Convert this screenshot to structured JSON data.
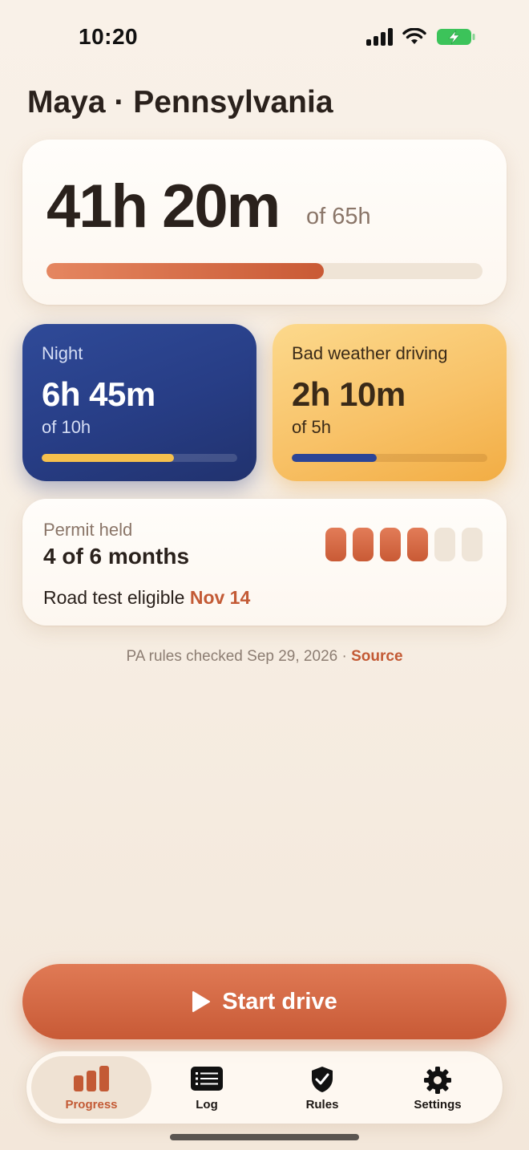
{
  "status_bar": {
    "time": "10:20",
    "icons": [
      "cellular-signal-icon",
      "wifi-icon",
      "battery-charging-icon"
    ],
    "battery_color": "#3cc35a"
  },
  "header": {
    "title": "Maya · Pennsylvania"
  },
  "total": {
    "value": "41h 20m",
    "of_label": "of 65h",
    "progress": 0.636,
    "fill_color": "#d46a45"
  },
  "night": {
    "label": "Night",
    "value": "6h 45m",
    "of_label": "of 10h",
    "progress": 0.675,
    "fill_color": "#f6c04d"
  },
  "weather": {
    "label": "Bad weather driving",
    "value": "2h 10m",
    "of_label": "of 5h",
    "progress": 0.433,
    "fill_color": "#2c4596"
  },
  "permit": {
    "label": "Permit held",
    "value": "4 of 6 months",
    "months_done": 4,
    "months_total": 6,
    "eligible_prefix": "Road test eligible",
    "eligible_date": "Nov 14"
  },
  "rules_note": {
    "text": "PA rules checked Sep 29, 2026 ·",
    "link_label": "Source"
  },
  "start_button": {
    "label": "Start drive",
    "icon": "play-icon"
  },
  "tab_bar": {
    "tabs": [
      {
        "label": "Progress",
        "icon": "bar-chart-icon",
        "active": true
      },
      {
        "label": "Log",
        "icon": "list-icon",
        "active": false
      },
      {
        "label": "Rules",
        "icon": "shield-check-icon",
        "active": false
      },
      {
        "label": "Settings",
        "icon": "gear-icon",
        "active": false
      }
    ]
  },
  "colors": {
    "accent": "#c35a35",
    "night_card": "#273d85",
    "weather_card": "#f8c268",
    "background": "#f7eee4"
  }
}
